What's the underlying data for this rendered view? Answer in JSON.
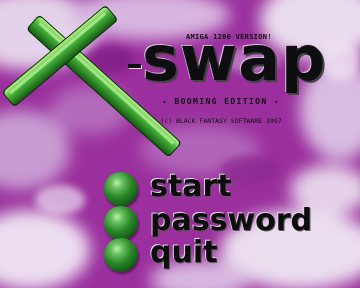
{
  "header": {
    "version_tag": "AMIGA 1200 VERSION!",
    "title": "swap",
    "edition": "- BOOMING EDITION -",
    "copyright": "(c) BLACK FANTASY SOFTWARE 1997"
  },
  "menu": {
    "items": [
      {
        "label": "start"
      },
      {
        "label": "password"
      },
      {
        "label": "quit"
      }
    ]
  },
  "colors": {
    "background": "#9a2f9d",
    "cloud_light": "#e9d9ee",
    "logo_green": "#2f9a2a",
    "title_text": "#0e0e10"
  },
  "icons": {
    "logo": "x-logo-icon",
    "menu_bullet": "green-orb-icon"
  }
}
